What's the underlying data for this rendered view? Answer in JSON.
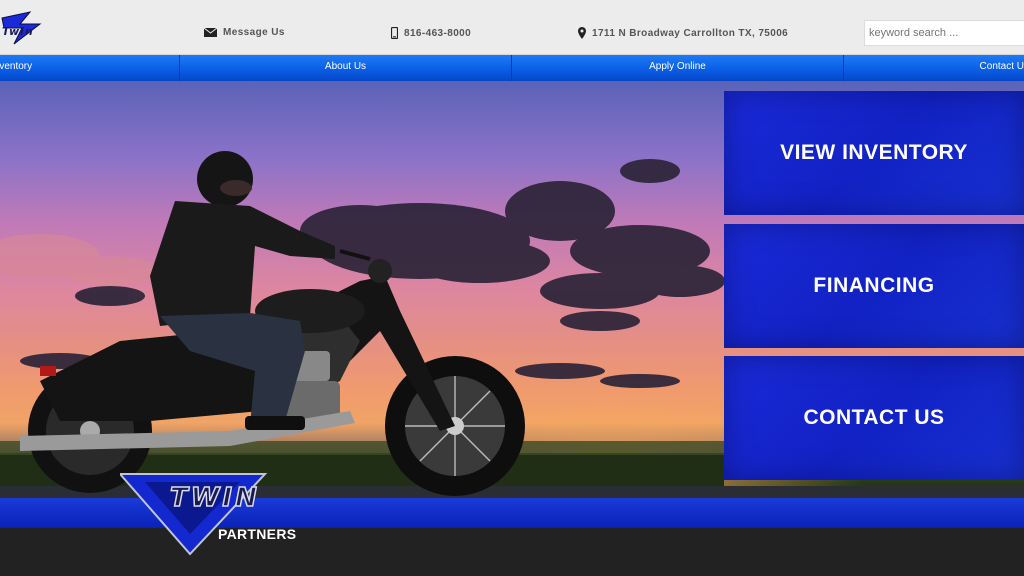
{
  "header": {
    "logo_small_text": "Twin",
    "message_label": "Message Us",
    "phone": "816-463-8000",
    "address": "1711 N Broadway Carrollton TX, 75006",
    "search_placeholder": "keyword search ..."
  },
  "nav": {
    "items": [
      {
        "label": "Inventory"
      },
      {
        "label": "About Us"
      },
      {
        "label": "Apply Online"
      },
      {
        "label": "Contact U"
      }
    ]
  },
  "cta": {
    "view_inventory": "VIEW INVENTORY",
    "financing": "FINANCING",
    "contact_us": "CONTACT US"
  },
  "brand": {
    "logo_word": "TWIN",
    "partners": "PARTNERS",
    "accent_color": "#1428d0",
    "nav_color": "#0a5fe6"
  },
  "icons": {
    "message": "envelope-icon",
    "phone": "phone-icon",
    "address": "map-pin-icon"
  }
}
